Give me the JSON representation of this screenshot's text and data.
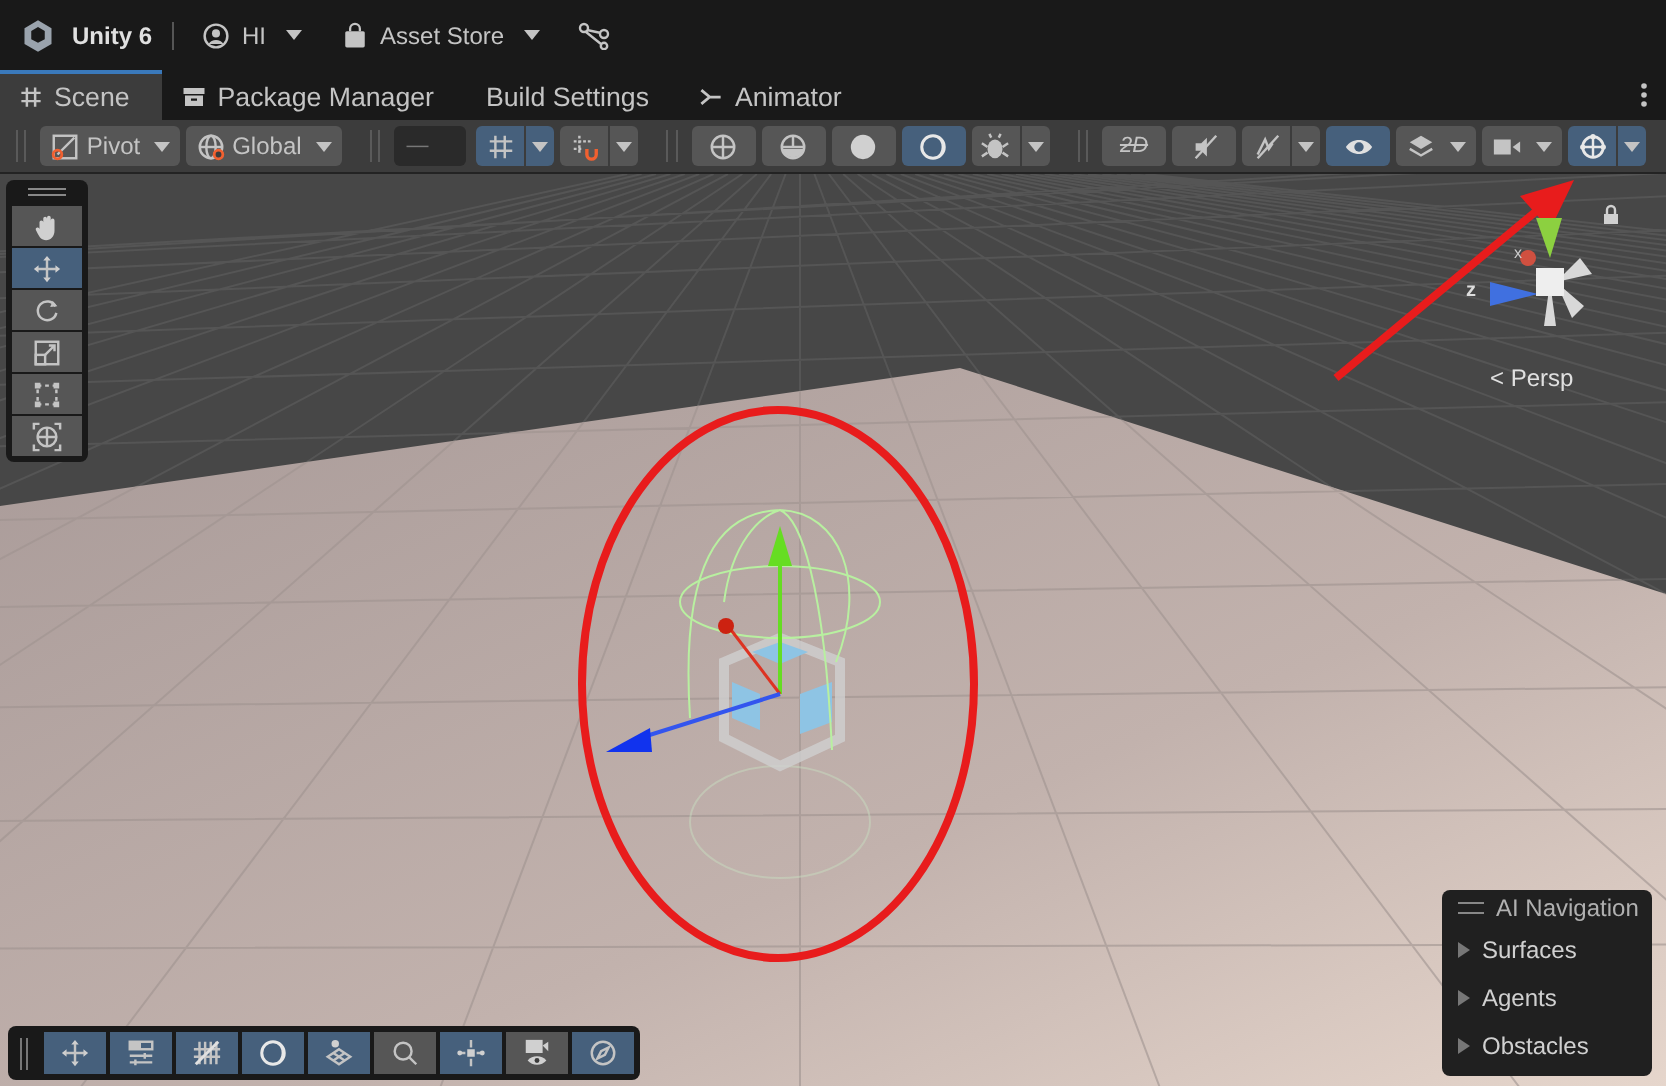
{
  "top_bar": {
    "product": "Unity 6",
    "account": "HI",
    "store": "Asset Store"
  },
  "tabs": [
    {
      "label": "Scene",
      "selected": true
    },
    {
      "label": "Package Manager",
      "selected": false
    },
    {
      "label": "Build Settings",
      "selected": false
    },
    {
      "label": "Animator",
      "selected": false
    }
  ],
  "toolbar": {
    "groups": [
      {
        "items": [
          {
            "kind": "dropdown",
            "label": "Pivot"
          },
          {
            "kind": "dropdown",
            "label": "Global"
          }
        ]
      },
      {
        "items": [
          {
            "kind": "field",
            "value": "—"
          },
          {
            "kind": "split",
            "selected": true
          },
          {
            "kind": "split",
            "selected": false
          }
        ]
      },
      {
        "items": [
          {
            "kind": "button",
            "selected": false
          },
          {
            "kind": "button",
            "selected": false
          },
          {
            "kind": "button",
            "selected": false
          },
          {
            "kind": "button",
            "selected": true
          },
          {
            "kind": "split",
            "selected": false
          }
        ]
      },
      {
        "items": [
          {
            "kind": "button",
            "label": "2D",
            "selected": false
          },
          {
            "kind": "button",
            "selected": false
          },
          {
            "kind": "split",
            "selected": false
          },
          {
            "kind": "button",
            "selected": true
          },
          {
            "kind": "menu",
            "selected": false
          },
          {
            "kind": "menu",
            "selected": false
          },
          {
            "kind": "split",
            "selected": true
          }
        ]
      }
    ]
  },
  "tools": [
    {
      "selected": false
    },
    {
      "selected": true
    },
    {
      "selected": false
    },
    {
      "selected": false
    },
    {
      "selected": false
    },
    {
      "selected": false
    }
  ],
  "view_label": "< Persp",
  "axis_labels": {
    "x": "x",
    "z": "z"
  },
  "overlay_toolbar": [
    {
      "on": true
    },
    {
      "on": true
    },
    {
      "on": true
    },
    {
      "on": true
    },
    {
      "on": true
    },
    {
      "on": false
    },
    {
      "on": true
    },
    {
      "on": false
    },
    {
      "on": true
    }
  ],
  "ai_navigation": {
    "title": "AI Navigation",
    "items": [
      {
        "label": "Surfaces",
        "expanded": false
      },
      {
        "label": "Agents",
        "expanded": false
      },
      {
        "label": "Obstacles",
        "expanded": false
      }
    ]
  }
}
